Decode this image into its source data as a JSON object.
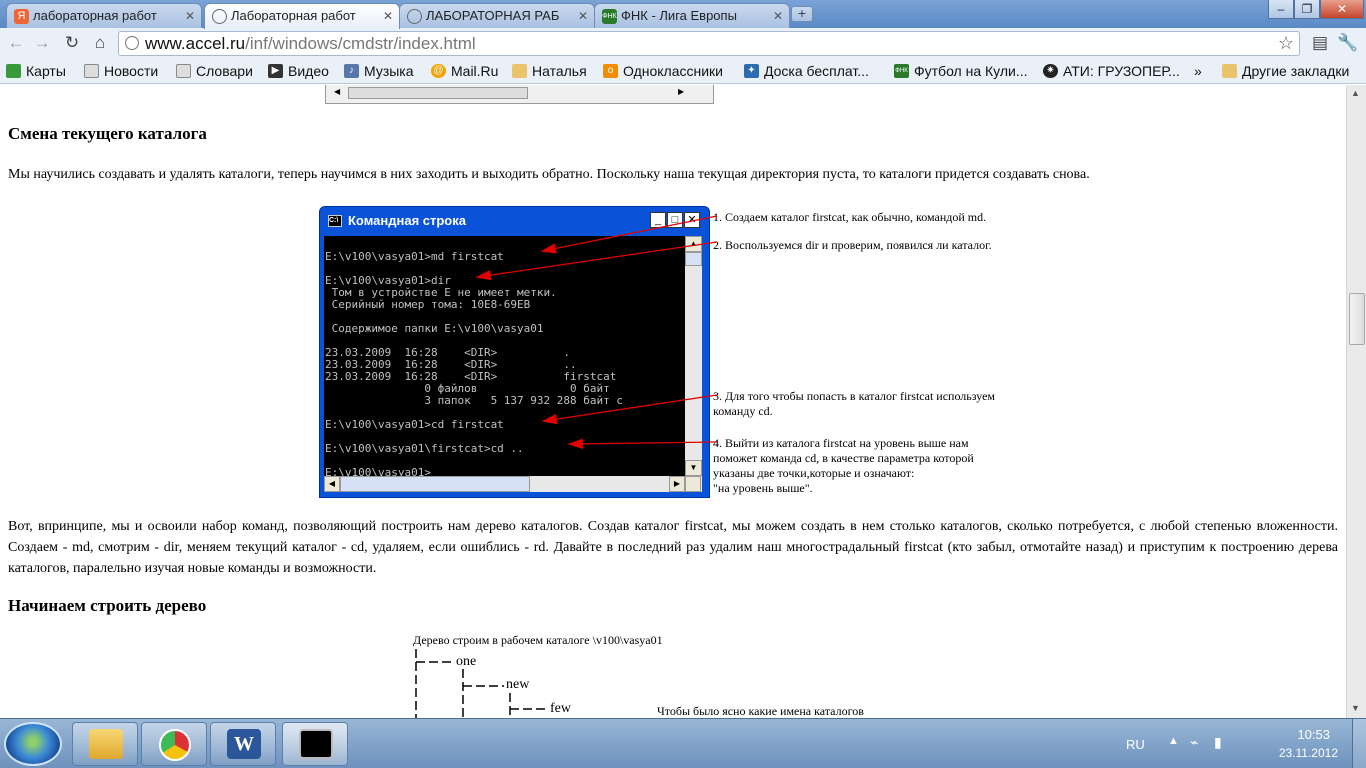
{
  "tabs": [
    {
      "title": "лабораторная работ",
      "favicon": "yandex-icon",
      "active": false
    },
    {
      "title": "Лабораторная работ",
      "favicon": "globe-icon",
      "active": true
    },
    {
      "title": "ЛАБОРАТОРНАЯ РАБ",
      "favicon": "globe-icon",
      "active": false
    },
    {
      "title": "ФНК - Лига Европы",
      "favicon": "fnk-icon",
      "active": false
    }
  ],
  "address": {
    "host": "www.accel.ru",
    "path": "/inf/windows/cmdstr/index.html"
  },
  "bookmarks": [
    {
      "label": "Карты",
      "icon": "maps-icon"
    },
    {
      "label": "Новости",
      "icon": "page-icon"
    },
    {
      "label": "Словари",
      "icon": "page-icon"
    },
    {
      "label": "Видео",
      "icon": "play-icon"
    },
    {
      "label": "Музыка",
      "icon": "music-icon"
    },
    {
      "label": "Mail.Ru",
      "icon": "mail-icon"
    },
    {
      "label": "Наталья",
      "icon": "folder-icon"
    },
    {
      "label": "Одноклассники",
      "icon": "ok-icon"
    },
    {
      "label": "Доска бесплат...",
      "icon": "board-icon"
    },
    {
      "label": "Футбол на Кули...",
      "icon": "fnk-icon"
    },
    {
      "label": "АТИ: ГРУЗОПЕР...",
      "icon": "ati-icon"
    },
    {
      "label": "Другие закладки",
      "icon": "folder-icon"
    }
  ],
  "content": {
    "heading1": "Смена текущего каталога",
    "para1": "Мы научились создавать и удалять каталоги, теперь научимся в них заходить и выходить обратно. Поскольку наша текущая директория пуста, то каталоги придется создавать снова.",
    "console": {
      "title": "Командная строка",
      "lines": [
        "",
        "E:\\v100\\vasya01>md firstcat",
        "",
        "E:\\v100\\vasya01>dir",
        " Том в устройстве E не имеет метки.",
        " Серийный номер тома: 10E8-69EB",
        "",
        " Содержимое папки E:\\v100\\vasya01",
        "",
        "23.03.2009  16:28    <DIR>          .",
        "23.03.2009  16:28    <DIR>          ..",
        "23.03.2009  16:28    <DIR>          firstcat",
        "               0 файлов              0 байт",
        "               3 папок   5 137 932 288 байт с",
        "",
        "E:\\v100\\vasya01>cd firstcat",
        "",
        "E:\\v100\\vasya01\\firstcat>cd ..",
        "",
        "E:\\v100\\vasya01>_"
      ]
    },
    "annotations": [
      {
        "lines": [
          "1. Создаем каталог firstcat, как обычно, командой md."
        ]
      },
      {
        "lines": [
          "2. Воспользуемся dir и проверим, появился ли каталог."
        ]
      },
      {
        "lines": [
          "3. Для того чтобы попасть в каталог  firstcat используем",
          "команду cd."
        ]
      },
      {
        "lines": [
          "4. Выйти из каталога firstcat на уровень выше нам",
          " поможет команда cd, в качестве параметра которой",
          " указаны две точки,которые и означают:",
          "\"на уровень выше\"."
        ]
      }
    ],
    "para2": "Вот, впринципе, мы и освоили набор команд, позволяющий построить нам дерево каталогов. Создав каталог firstcat, мы можем создать в нем столько каталогов, сколько потребуется, с любой степенью вложенности. Создаем - md, смотрим - dir, меняем текущий каталог - cd, удаляем, если ошиблись - rd. Давайте в последний раз удалим наш многострадальный firstcat (кто забыл, отмотайте назад) и приступим к построению дерева каталогов, паралельно изучая новые команды и возможности.",
    "heading2": "Начинаем строить дерево",
    "tree": {
      "caption": "Дерево строим в рабочем каталоге \\v100\\vasya01",
      "nodes": [
        "one",
        "new",
        "few"
      ],
      "side_note": "Чтобы было ясно какие имена каталогов"
    }
  },
  "taskbar": {
    "apps": [
      {
        "name": "explorer-icon"
      },
      {
        "name": "chrome-icon"
      },
      {
        "name": "word-icon"
      },
      {
        "name": "cmd-icon"
      }
    ],
    "tray": {
      "lang": "RU",
      "time": "10:53",
      "date": "23.11.2012"
    }
  }
}
